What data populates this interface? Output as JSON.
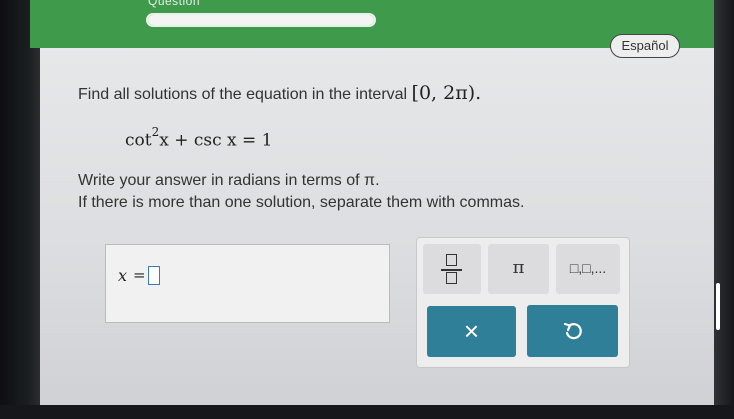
{
  "header": {
    "title": "Question",
    "progress_fraction": 1.0
  },
  "language_button": "Español",
  "question": {
    "instruction": "Find all solutions of the equation in the interval",
    "interval": "[0, 2π).",
    "equation_part1": "cot",
    "equation_exponent": "2",
    "equation_part2": "x + csc x = 1",
    "answer_format": "Write your answer in radians in terms of π.",
    "multiple_solutions": "If there is more than one solution, separate them with commas."
  },
  "answer": {
    "variable": "x",
    "equals": "=",
    "value": ""
  },
  "keypad": {
    "pi_key": "π",
    "list_key": "□,□,...",
    "clear_key": "×"
  },
  "colors": {
    "header_green": "#3f9a4b",
    "button_teal": "#2e7f97",
    "input_focus_blue": "#3b78c4"
  }
}
